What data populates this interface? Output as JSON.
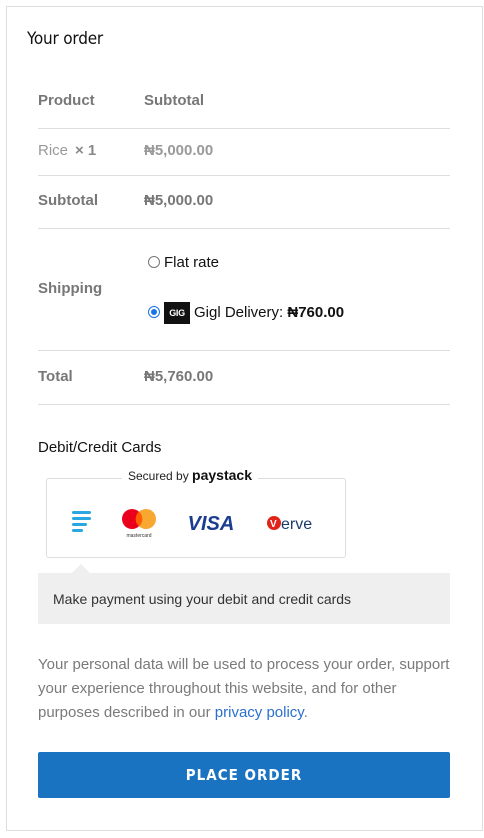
{
  "heading": "Your order",
  "table": {
    "col_product": "Product",
    "col_subtotal": "Subtotal",
    "item": {
      "name": "Rice",
      "qty": "× 1",
      "subtotal": "₦5,000.00"
    },
    "subtotal_label": "Subtotal",
    "subtotal_value": "₦5,000.00",
    "shipping_label": "Shipping",
    "shipping_options": [
      {
        "label": "Flat rate",
        "selected": false
      },
      {
        "logo": "GIG",
        "label": "Gigl Delivery: ",
        "price": "₦760.00",
        "selected": true
      }
    ],
    "total_label": "Total",
    "total_value": "₦5,760.00"
  },
  "payment": {
    "method_title": "Debit/Credit Cards",
    "secured_prefix": "Secured by",
    "secured_brand": "paystack",
    "card_logos": [
      "paystack-icon",
      "mastercard-icon",
      "visa-icon",
      "verve-icon"
    ],
    "description": "Make payment using your debit and credit cards"
  },
  "privacy": {
    "text": "Your personal data will be used to process your order, support your experience throughout this website, and for other purposes described in our ",
    "link": "privacy policy",
    "end": "."
  },
  "place_order": "PLACE ORDER",
  "colors": {
    "accent": "#1a73c0",
    "radio": "#1a73e8",
    "link": "#2a6fcf"
  }
}
